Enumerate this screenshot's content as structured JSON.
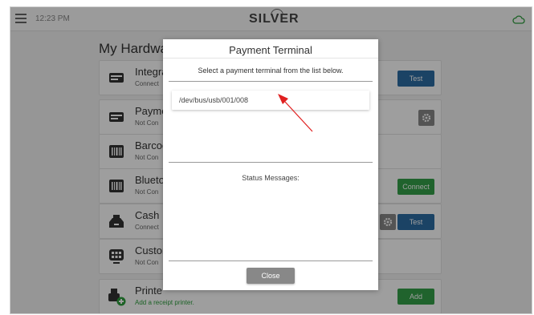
{
  "topbar": {
    "time": "12:23 PM",
    "brand": "SILVER"
  },
  "page": {
    "heading": "My Hardware"
  },
  "cards": [
    {
      "title": "Integra",
      "subtitle": "Connect"
    },
    {
      "title": "Payme",
      "subtitle": "Not Con"
    },
    {
      "title": "Barcod",
      "subtitle": "Not Con"
    },
    {
      "title": "Blueto",
      "subtitle": "Not Con"
    },
    {
      "title": "Cash D",
      "subtitle": "Connect"
    },
    {
      "title": "Custon",
      "subtitle": "Not Con"
    },
    {
      "title": "Printe",
      "subtitle": "Add a receipt printer."
    }
  ],
  "buttons": {
    "test": "Test",
    "connect": "Connect",
    "add": "Add"
  },
  "modal": {
    "title": "Payment Terminal",
    "instruction": "Select a payment terminal from the list below.",
    "devices": [
      "/dev/bus/usb/001/008"
    ],
    "status_label": "Status Messages:",
    "close_label": "Close"
  },
  "colors": {
    "primary_blue": "#2d6da3",
    "success_green": "#35a14a",
    "arrow_red": "#e02020"
  },
  "icons": [
    "menu-icon",
    "cloud-icon",
    "card-reader-icon",
    "barcode-icon",
    "cash-drawer-icon",
    "customer-display-icon",
    "printer-add-icon",
    "gear-icon"
  ]
}
